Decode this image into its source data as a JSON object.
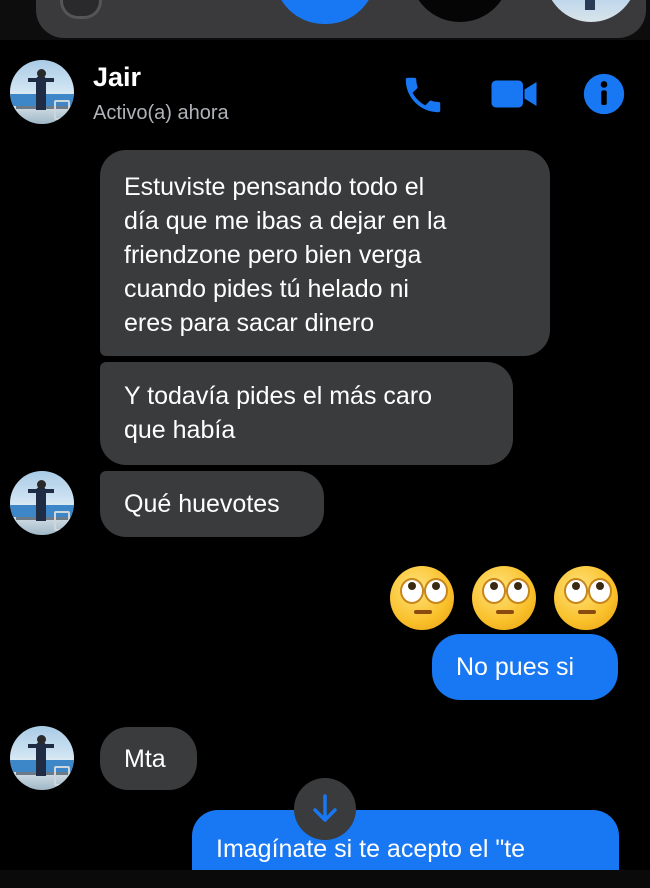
{
  "header": {
    "contact_name": "Jair",
    "status": "Activo(a) ahora"
  },
  "messages": [
    {
      "direction": "incoming",
      "lines": [
        "Estuviste pensando todo el",
        "día que me ibas a dejar en la",
        "friendzone pero bien verga",
        "cuando pides tú helado ni",
        "eres para sacar dinero"
      ]
    },
    {
      "direction": "incoming",
      "lines": [
        "Y todavía pides el más caro",
        "que había"
      ]
    },
    {
      "direction": "incoming",
      "lines": [
        "Qué huevotes"
      ]
    },
    {
      "direction": "outgoing",
      "type": "emoji",
      "emoji": [
        "🙄",
        "🙄",
        "🙄"
      ]
    },
    {
      "direction": "outgoing",
      "lines": [
        "No pues si"
      ]
    },
    {
      "direction": "incoming",
      "lines": [
        "Mta"
      ]
    },
    {
      "direction": "outgoing",
      "lines": [
        "Imagínate si te acepto el \"te"
      ]
    }
  ],
  "icons": {
    "call": "phone-icon",
    "video": "video-camera-icon",
    "info": "info-icon",
    "scroll": "arrow-down-icon"
  },
  "colors": {
    "background": "#000000",
    "incoming_bubble": "#3a3b3c",
    "outgoing_bubble": "#1877f2",
    "accent": "#1877f2"
  }
}
